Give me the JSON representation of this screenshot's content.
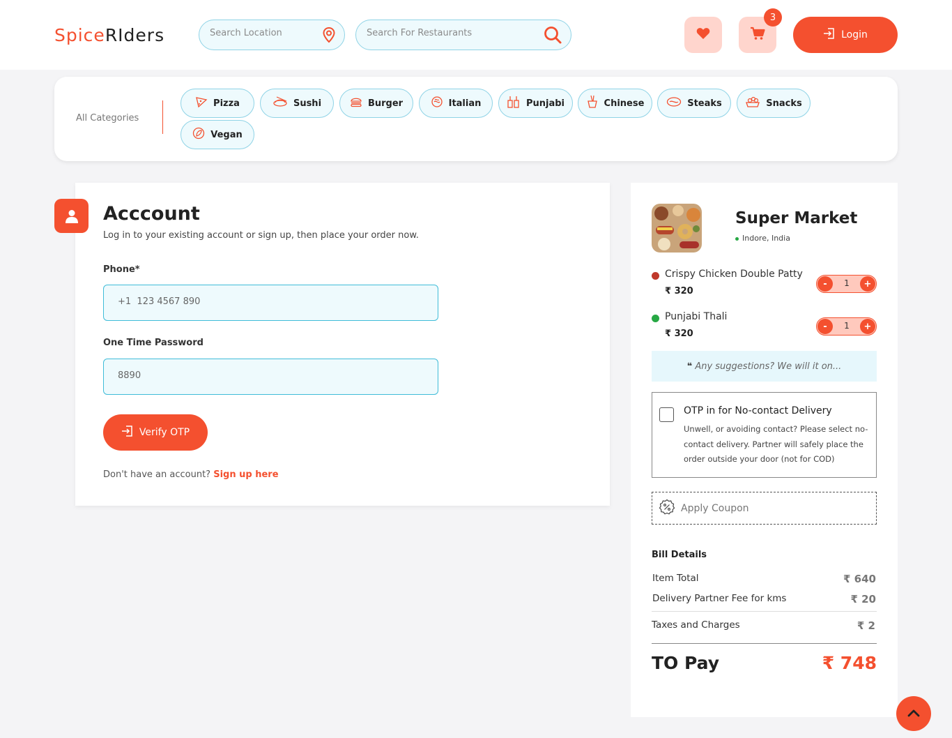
{
  "header": {
    "logo_part1": "Spice",
    "logo_part2": "RIders",
    "location_placeholder": "Search Location",
    "restaurant_placeholder": "Search For Restaurants",
    "cart_count": "3",
    "login_label": "Login"
  },
  "categories": {
    "label": "All Categories",
    "items": [
      {
        "label": "Pizza",
        "icon": "pizza-icon"
      },
      {
        "label": "Sushi",
        "icon": "sushi-icon"
      },
      {
        "label": "Burger",
        "icon": "burger-icon"
      },
      {
        "label": "Italian",
        "icon": "italian-icon"
      },
      {
        "label": "Punjabi",
        "icon": "punjabi-icon"
      },
      {
        "label": "Chinese",
        "icon": "chinese-icon"
      },
      {
        "label": "Steaks",
        "icon": "steak-icon"
      },
      {
        "label": "Snacks",
        "icon": "snacks-icon"
      },
      {
        "label": "Vegan",
        "icon": "vegan-icon"
      }
    ]
  },
  "account": {
    "title": "Acccount",
    "subtitle": "Log in to your existing account or sign up, then place your order now.",
    "phone_label": "Phone*",
    "phone_placeholder": "+1  123 4567 890",
    "otp_label": "One Time Password",
    "otp_placeholder": "8890",
    "verify_label": "Verify OTP",
    "signup_text": "Don't have an account?",
    "signup_link": "Sign up here"
  },
  "cart": {
    "store_name": "Super Market",
    "store_location": "Indore, India",
    "items": [
      {
        "name": "Crispy Chicken Double Patty",
        "price": "₹ 320",
        "qty": "1",
        "dot_color": "#c0392b"
      },
      {
        "name": "Punjabi Thali",
        "price": "₹ 320",
        "qty": "1",
        "dot_color": "#27a844"
      }
    ],
    "suggestion_placeholder": "Any suggestions? We will it on...",
    "otp_title": "OTP in for No-contact Delivery",
    "otp_desc": "Unwell, or avoiding contact? Please select no-contact delivery. Partner will safely place the order outside your door (not for COD)",
    "coupon_label": "Apply Coupon",
    "bill_title": "Bill Details",
    "bill": {
      "item_total_label": "Item Total",
      "item_total_value": "₹ 640",
      "delivery_label": "Delivery Partner Fee for kms",
      "delivery_value": "₹ 20",
      "taxes_label": "Taxes and Charges",
      "taxes_value": "₹ 2",
      "to_pay_label": "TO Pay",
      "to_pay_value": "₹ 748"
    }
  },
  "colors": {
    "accent": "#f4502f",
    "input_bg": "#eefafd",
    "input_border": "#8fd3e6"
  }
}
